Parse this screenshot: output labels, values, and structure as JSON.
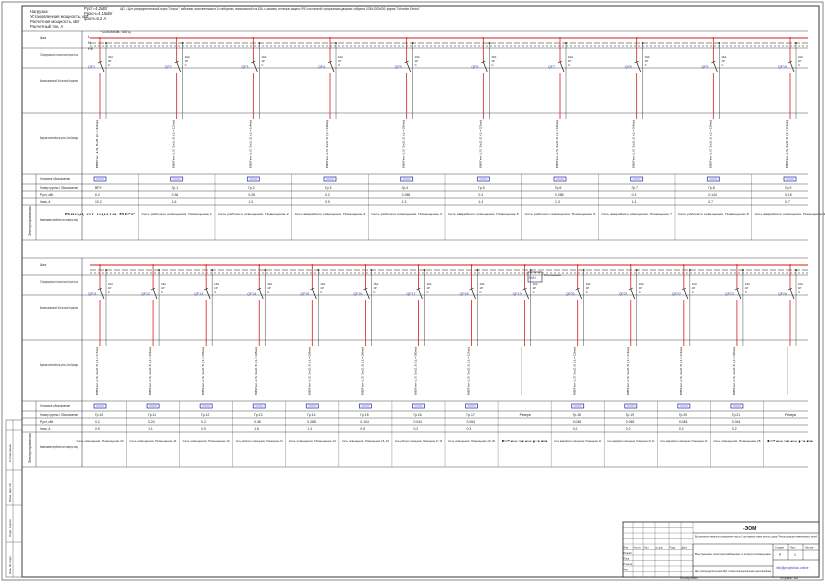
{
  "header_note": {
    "lines": [
      "Нагрузка:",
      "Установленная мощность, кВт",
      "Расчетная мощность, кВт",
      "Расчетный ток, А"
    ],
    "values": [
      "Руст=4.2кВт",
      "Ррасч=4.15кВт",
      "Iрасч=6.2 А"
    ],
    "description": "ЩО – Щит распределительный серии \"Открыт\", кабелями, выполненными в 2х нейтралях, номинальный ток 63А; с шинами; степенью защиты IP41 постоянной; прозрачными дверьми; габариты 1000х1000х250; фирма \"Schneider Electric\""
  },
  "feeder": {
    "label": "~220/380В; 50Гц",
    "phase_labels": [
      "L",
      "N",
      "PE"
    ]
  },
  "row_labels": [
    "Шина",
    "В.Т.Е. Защитный дифференциальный выключатель. Тип. Номинальный ток/ток отключения, мА Тип расцепителя. Кол. полюсов",
    "Выключатель автоматический. Ток Кол-во полюсов Тип расцепителя",
    "Маркировка и сечение кабеля, мм², длина, м. Способ прокладки",
    "Условное обозначение",
    "Номер группы / Обозначение",
    "Руст, кВт",
    "Iном, А",
    "Наименование потребителя и его номер по плану"
  ],
  "side_label": "Электроприемники",
  "row1_groups": [
    {
      "breaker": "QF1",
      "rating": "32А",
      "poles": "3P",
      "curve": "C",
      "cable": "ВВГнг-LS 5х6 (L=40м)",
      "group": "ВРУ",
      "pset": "6.2",
      "inom": "10.2",
      "consumer": "Ввод от щита ВРУ"
    },
    {
      "breaker": "QF2",
      "rating": "10А",
      "poles": "1P",
      "curve": "C",
      "cable": "ВВГнг-LS 3х1.5 (L=12м)",
      "group": "Гр.1",
      "pset": "0.36",
      "inom": "1.6",
      "consumer": "Сеть рабочего освещения. Помещение 1"
    },
    {
      "breaker": "QF3",
      "rating": "10А",
      "poles": "1P",
      "curve": "C",
      "cable": "ВВГнг-LS 3х1.5 (L=14м)",
      "group": "Гр.2",
      "pset": "0.28",
      "inom": "1.3",
      "consumer": "Сеть рабочего освещения. Помещение 2"
    },
    {
      "breaker": "QF4",
      "rating": "10А",
      "poles": "1P",
      "curve": "C",
      "cable": "ВВГнг-LS 3х1.5 (L=18м)",
      "group": "Гр.3",
      "pset": "0.2",
      "inom": "0.9",
      "consumer": "Сеть аварийного освещения. Помещение 3"
    },
    {
      "breaker": "QF5",
      "rating": "16А",
      "poles": "1P",
      "curve": "C",
      "cable": "ВВГнг-LS 3х2.5 (L=20м)",
      "group": "Гр.4",
      "pset": "0.288",
      "inom": "1.3",
      "consumer": "Сеть рабочего освещения. Помещение 4"
    },
    {
      "breaker": "QF6",
      "rating": "16А",
      "poles": "1P",
      "curve": "C",
      "cable": "ВВГнг-LS 3х2.5 (L=22м)",
      "group": "Гр.5",
      "pset": "0.3",
      "inom": "1.4",
      "consumer": "Сеть аварийного освещения. Помещение 5"
    },
    {
      "breaker": "QF7",
      "rating": "16А",
      "poles": "1P",
      "curve": "C",
      "cable": "ВВГнг-LS 3х2.5 (L=16м)",
      "group": "Гр.6",
      "pset": "0.288",
      "inom": "1.3",
      "consumer": "Сеть рабочего освещения. Помещение 6"
    },
    {
      "breaker": "QF8",
      "rating": "16А",
      "poles": "1P",
      "curve": "C",
      "cable": "ВВГнг-LS 3х2.5 (L=24м)",
      "group": "Гр.7",
      "pset": "0.3",
      "inom": "1.4",
      "consumer": "Сеть аварийного освещения. Помещение 7"
    },
    {
      "breaker": "QF9",
      "rating": "16А",
      "poles": "1P",
      "curve": "C",
      "cable": "ВВГнг-LS 3х2.5 (L=19м)",
      "group": "Гр.8",
      "pset": "0.144",
      "inom": "0.7",
      "consumer": "Сеть рабочего освещения. Помещение 8"
    },
    {
      "breaker": "QF10",
      "rating": "16А",
      "poles": "1P",
      "curve": "C",
      "cable": "ВВГнг-LS 3х2.5 (L=21м)",
      "group": "Гр.9",
      "pset": "0.15",
      "inom": "0.7",
      "consumer": "Сеть аварийного освещения. Помещение 9"
    }
  ],
  "row2_groups": [
    {
      "breaker": "QF11",
      "rating": "16А",
      "poles": "1P",
      "curve": "C",
      "cable": "ВВГнг-LS 3х2.5 (L=17м)",
      "group": "Гр.10",
      "pset": "0.2",
      "inom": "0.9",
      "consumer": "Сеть освещения. Помещение 10"
    },
    {
      "breaker": "QF12",
      "rating": "16А",
      "poles": "1P",
      "curve": "C",
      "cable": "ВВГнг-LS 3х2.5 (L=23м)",
      "group": "Гр.11",
      "pset": "0.24",
      "inom": "1.1",
      "consumer": "Сеть освещения. Помещение 11"
    },
    {
      "breaker": "QF13",
      "rating": "16А",
      "poles": "1P",
      "curve": "C",
      "cable": "ВВГнг-LS 3х2.5 (L=25м)",
      "group": "Гр.12",
      "pset": "0.2",
      "inom": "0.9",
      "consumer": "Сеть освещения. Помещение 12"
    },
    {
      "breaker": "QF14",
      "rating": "16А",
      "poles": "1P",
      "curve": "C",
      "cable": "ВВГнг-LS 3х2.5 (L=18м)",
      "group": "Гр.13",
      "pset": "0.36",
      "inom": "1.6",
      "consumer": "Сеть рабочего освещения. Помещение 13"
    },
    {
      "breaker": "QF15",
      "rating": "16А",
      "poles": "1P",
      "curve": "C",
      "cable": "ВВГнг-LS 3х2.5 (L=28м)",
      "group": "Гр.14",
      "pset": "0.288",
      "inom": "1.3",
      "consumer": "Сеть освещения. Помещение 14"
    },
    {
      "breaker": "QF16",
      "rating": "16А",
      "poles": "1P",
      "curve": "C",
      "cable": "ВВГнг-LS 3х2.5 (L=26м)",
      "group": "Гр.15",
      "pset": "0.104",
      "inom": "0.5",
      "consumer": "Сеть освещения. Помещение 15, 16"
    },
    {
      "breaker": "QF17",
      "rating": "16А",
      "poles": "1P",
      "curve": "C",
      "cable": "ВВГнг-LS 3х2.5 (L=30м)",
      "group": "Гр.16",
      "pset": "0.044",
      "inom": "0.2",
      "consumer": "Сеть рабочего освещения. Помещение 17, 18"
    },
    {
      "breaker": "QF18",
      "rating": "16А",
      "poles": "1P",
      "curve": "C",
      "cable": "ВВГнг-LS 3х2.5 (L=12м)",
      "group": "Гр.17",
      "pset": "0.064",
      "inom": "0.3",
      "consumer": "Сеть освещения. Помещение 19, 20"
    },
    {
      "breaker": "QF19",
      "rating": "16А",
      "poles": "1P",
      "curve": "C",
      "cable": "—",
      "group": "Резерв",
      "pset": "",
      "inom": "",
      "consumer": "Резерв"
    },
    {
      "breaker": "QF20",
      "rating": "16А",
      "poles": "1P",
      "curve": "C",
      "cable": "ВВГнг-LS 3х2.5 (L=15м)",
      "group": "Гр.18",
      "pset": "0.048",
      "inom": "0.2",
      "consumer": "Сеть аварийного освещения. Помещение 21"
    },
    {
      "breaker": "QF21",
      "rating": "16А",
      "poles": "1P",
      "curve": "C",
      "cable": "ВВГнг-LS 3х2.5 (L=14м)",
      "group": "Гр.19",
      "pset": "0.048",
      "inom": "0.2",
      "consumer": "Сеть аварийного освещения. Помещение 22, 23"
    },
    {
      "breaker": "QF22",
      "rating": "16А",
      "poles": "1P",
      "curve": "C",
      "cable": "ВВГнг-LS 3х2.5 (L=13м)",
      "group": "Гр.20",
      "pset": "0.048",
      "inom": "0.2",
      "consumer": "Сеть аварийного освещения. Помещение 24"
    },
    {
      "breaker": "QF23",
      "rating": "16А",
      "poles": "1P",
      "curve": "C",
      "cable": "ВВГнг-LS 3х2.5 (L=20м)",
      "group": "Гр.21",
      "pset": "0.044",
      "inom": "0.2",
      "consumer": "Сеть освещения. Помещение 25"
    },
    {
      "breaker": "QF24",
      "rating": "16А",
      "poles": "1P",
      "curve": "C",
      "cable": "—",
      "group": "Резерв",
      "pset": "",
      "inom": "",
      "consumer": "Резерв"
    }
  ],
  "relay": {
    "label": "KM1",
    "note": "Реле времени"
  },
  "title_block": {
    "code": "-ЭОМ",
    "object": "Встроенные нежилые помещения части 1 на первом этаже жилого дома. Реконструкция инженерных сетей",
    "section": "Внутреннее электроснабжение и электроосвещение",
    "drawing": "Щит распределительный ЩО. Схема принципиальная однолинейная",
    "stage": "Р",
    "sheet": "1",
    "sheets": "",
    "company": "info@projectdoc.online",
    "columns": [
      "Изм.",
      "Кол.уч.",
      "Лист",
      "№ док.",
      "Подп.",
      "Дата"
    ],
    "roles": [
      "Разраб.",
      "Пров.",
      "Н.контр.",
      "Утв."
    ],
    "stage_headers": [
      "Стадия",
      "Лист",
      "Листов"
    ]
  },
  "left_stamp": [
    "Инв. № подл.",
    "Подп. и дата",
    "Взам. инв. №",
    "Согласовано"
  ],
  "footer": {
    "left": "Копировал",
    "right": "Формат А3"
  },
  "colors": {
    "phase_line": "#d41e1e",
    "line": "#1a1a1a",
    "grid": "#4a4a4a",
    "device_accent": "#3a3ab8"
  }
}
